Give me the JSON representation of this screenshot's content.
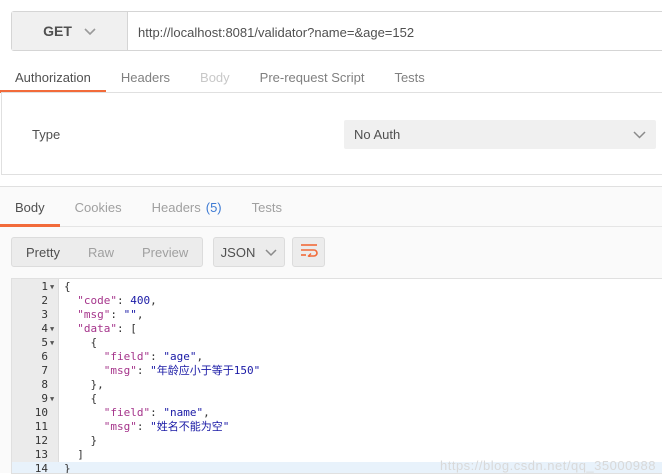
{
  "request": {
    "method": "GET",
    "url": "http://localhost:8081/validator?name=&age=152"
  },
  "request_tabs": [
    {
      "label": "Authorization",
      "state": "active"
    },
    {
      "label": "Headers",
      "state": "normal"
    },
    {
      "label": "Body",
      "state": "disabled"
    },
    {
      "label": "Pre-request Script",
      "state": "normal"
    },
    {
      "label": "Tests",
      "state": "normal"
    }
  ],
  "auth": {
    "type_label": "Type",
    "type_value": "No Auth"
  },
  "response_tabs": {
    "body": "Body",
    "cookies": "Cookies",
    "headers": "Headers",
    "headers_count": "(5)",
    "tests": "Tests"
  },
  "view_modes": [
    "Pretty",
    "Raw",
    "Preview"
  ],
  "format": "JSON",
  "code_lines": [
    {
      "n": "1",
      "fold": true
    },
    {
      "n": "2",
      "fold": false
    },
    {
      "n": "3",
      "fold": false
    },
    {
      "n": "4",
      "fold": true
    },
    {
      "n": "5",
      "fold": true
    },
    {
      "n": "6",
      "fold": false
    },
    {
      "n": "7",
      "fold": false
    },
    {
      "n": "8",
      "fold": false
    },
    {
      "n": "9",
      "fold": true
    },
    {
      "n": "10",
      "fold": false
    },
    {
      "n": "11",
      "fold": false
    },
    {
      "n": "12",
      "fold": false
    },
    {
      "n": "13",
      "fold": false
    },
    {
      "n": "14",
      "fold": false
    }
  ],
  "response_json": {
    "key_code": "\"code\"",
    "val_code": "400",
    "key_msg": "\"msg\"",
    "val_msg": "\"\"",
    "key_data": "\"data\"",
    "item1_key_field": "\"field\"",
    "item1_val_field": "\"age\"",
    "item1_key_msg": "\"msg\"",
    "item1_val_msg": "\"年龄应小于等于150\"",
    "item2_key_field": "\"field\"",
    "item2_val_field": "\"name\"",
    "item2_key_msg": "\"msg\"",
    "item2_val_msg": "\"姓名不能为空\""
  },
  "watermark": "https://blog.csdn.net/qq_35000988",
  "colors": {
    "accent": "#f26b3a",
    "link_blue": "#3e7bd4",
    "json_key": "#a5348b",
    "json_value": "#1a1aa6"
  },
  "icons": {
    "method_dropdown": "chevron-down-icon",
    "auth_dropdown": "chevron-down-icon",
    "format_dropdown": "chevron-down-icon",
    "wrap": "wrap-lines-icon",
    "fold": "fold-arrow-icon"
  }
}
